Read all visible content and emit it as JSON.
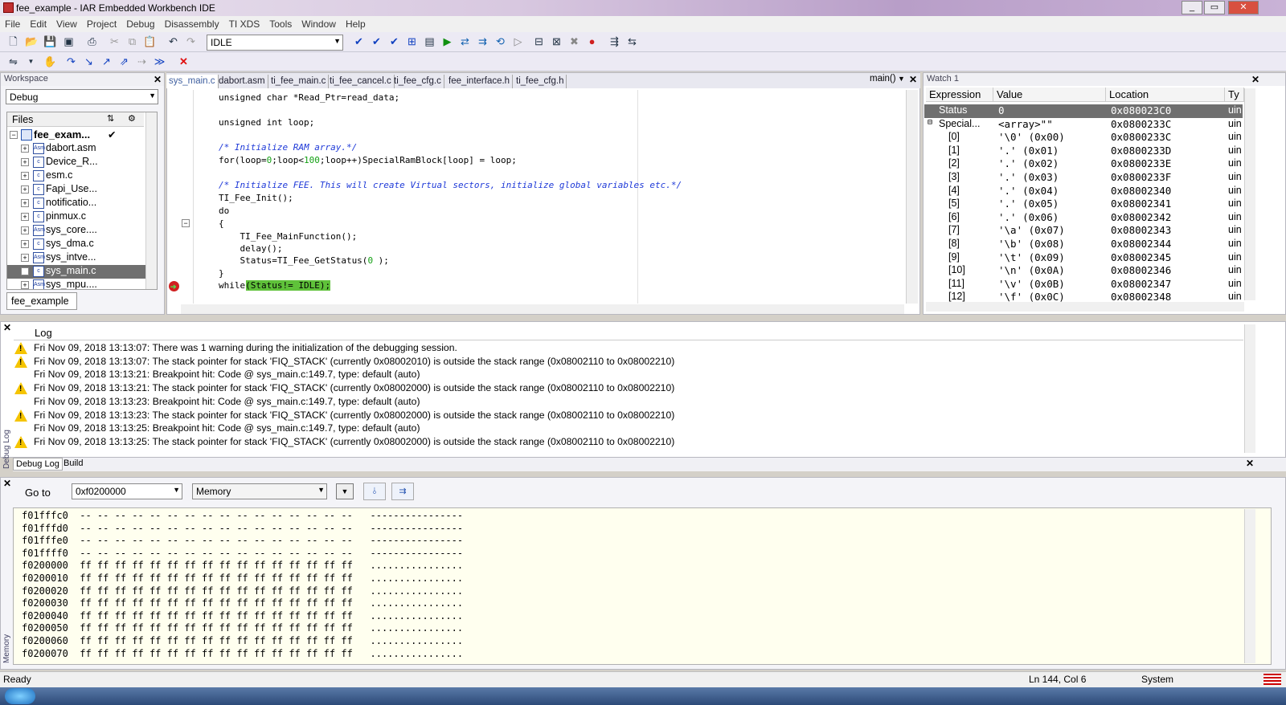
{
  "window": {
    "title": "fee_example - IAR Embedded Workbench IDE",
    "buttons": [
      "_",
      "▭",
      "✕"
    ]
  },
  "menu": [
    "File",
    "Edit",
    "View",
    "Project",
    "Debug",
    "Disassembly",
    "TI XDS",
    "Tools",
    "Window",
    "Help"
  ],
  "toolbar": {
    "config_combo": "IDLE"
  },
  "workspace": {
    "title": "Workspace",
    "config": "Debug",
    "files_header": "Files",
    "project": "fee_exam...",
    "files": [
      {
        "name": "dabort.asm",
        "type": "asm"
      },
      {
        "name": "Device_R...",
        "type": "c"
      },
      {
        "name": "esm.c",
        "type": "c"
      },
      {
        "name": "Fapi_Use...",
        "type": "c"
      },
      {
        "name": "notificatio...",
        "type": "c"
      },
      {
        "name": "pinmux.c",
        "type": "c"
      },
      {
        "name": "sys_core....",
        "type": "asm"
      },
      {
        "name": "sys_dma.c",
        "type": "c"
      },
      {
        "name": "sys_intve...",
        "type": "asm"
      },
      {
        "name": "sys_main.c",
        "type": "c"
      },
      {
        "name": "sys_mpu....",
        "type": "asm"
      }
    ],
    "bottom_tab": "fee_example"
  },
  "editor": {
    "tabs": [
      "sys_main.c",
      "dabort.asm",
      "ti_fee_main.c",
      "ti_fee_cancel.c",
      "ti_fee_cfg.c",
      "fee_interface.h",
      "ti_fee_cfg.h"
    ],
    "function": "main()",
    "lines": [
      "unsigned char *Read_Ptr=read_data;",
      "unsigned int loop;",
      "/* Initialize RAM array.*/",
      "for(loop=0;loop<100;loop++)SpecialRamBlock[loop] = loop;",
      "/* Initialize FEE. This will create Virtual sectors, initialize global variables etc.*/",
      "TI_Fee_Init();",
      "do",
      "{",
      "    TI_Fee_MainFunction();",
      "    delay();",
      "    Status=TI_Fee_GetStatus(0 );",
      "}",
      "while(Status!= IDLE);"
    ]
  },
  "watch": {
    "title": "Watch 1",
    "columns": [
      "Expression",
      "Value",
      "Location",
      "Ty"
    ],
    "rows": [
      {
        "expr": "Status",
        "value": "0",
        "loc": "0x080023C0",
        "type": "uin"
      },
      {
        "expr": "Special...",
        "value": "<array>\"\"",
        "loc": "0x0800233C",
        "type": "uin"
      },
      {
        "expr": "[0]",
        "value": "'\\0' (0x00)",
        "loc": "0x0800233C",
        "type": "uin"
      },
      {
        "expr": "[1]",
        "value": "'.' (0x01)",
        "loc": "0x0800233D",
        "type": "uin"
      },
      {
        "expr": "[2]",
        "value": "'.' (0x02)",
        "loc": "0x0800233E",
        "type": "uin"
      },
      {
        "expr": "[3]",
        "value": "'.' (0x03)",
        "loc": "0x0800233F",
        "type": "uin"
      },
      {
        "expr": "[4]",
        "value": "'.' (0x04)",
        "loc": "0x08002340",
        "type": "uin"
      },
      {
        "expr": "[5]",
        "value": "'.' (0x05)",
        "loc": "0x08002341",
        "type": "uin"
      },
      {
        "expr": "[6]",
        "value": "'.' (0x06)",
        "loc": "0x08002342",
        "type": "uin"
      },
      {
        "expr": "[7]",
        "value": "'\\a' (0x07)",
        "loc": "0x08002343",
        "type": "uin"
      },
      {
        "expr": "[8]",
        "value": "'\\b' (0x08)",
        "loc": "0x08002344",
        "type": "uin"
      },
      {
        "expr": "[9]",
        "value": "'\\t' (0x09)",
        "loc": "0x08002345",
        "type": "uin"
      },
      {
        "expr": "[10]",
        "value": "'\\n' (0x0A)",
        "loc": "0x08002346",
        "type": "uin"
      },
      {
        "expr": "[11]",
        "value": "'\\v' (0x0B)",
        "loc": "0x08002347",
        "type": "uin"
      },
      {
        "expr": "[12]",
        "value": "'\\f' (0x0C)",
        "loc": "0x08002348",
        "type": "uin"
      }
    ]
  },
  "log": {
    "header": "Log",
    "side_label": "Debug Log",
    "tabs": [
      "Debug Log",
      "Build"
    ],
    "entries": [
      {
        "warn": true,
        "text": "Fri Nov 09, 2018 13:13:07: There was 1 warning during the initialization of the debugging session."
      },
      {
        "warn": true,
        "text": "Fri Nov 09, 2018 13:13:07: The stack pointer for stack 'FIQ_STACK' (currently 0x08002010) is outside the stack range (0x08002110 to 0x08002210)"
      },
      {
        "warn": false,
        "text": "Fri Nov 09, 2018 13:13:21: Breakpoint hit: Code @ sys_main.c:149.7, type: default (auto)"
      },
      {
        "warn": true,
        "text": "Fri Nov 09, 2018 13:13:21: The stack pointer for stack 'FIQ_STACK' (currently 0x08002000) is outside the stack range (0x08002110 to 0x08002210)"
      },
      {
        "warn": false,
        "text": "Fri Nov 09, 2018 13:13:23: Breakpoint hit: Code @ sys_main.c:149.7, type: default (auto)"
      },
      {
        "warn": true,
        "text": "Fri Nov 09, 2018 13:13:23: The stack pointer for stack 'FIQ_STACK' (currently 0x08002000) is outside the stack range (0x08002110 to 0x08002210)"
      },
      {
        "warn": false,
        "text": "Fri Nov 09, 2018 13:13:25: Breakpoint hit: Code @ sys_main.c:149.7, type: default (auto)"
      },
      {
        "warn": true,
        "text": "Fri Nov 09, 2018 13:13:25: The stack pointer for stack 'FIQ_STACK' (currently 0x08002000) is outside the stack range (0x08002110 to 0x08002210)"
      }
    ]
  },
  "memory": {
    "goto_label": "Go to",
    "goto_value": "0xf0200000",
    "zone": "Memory",
    "side_label": "Memory",
    "rows": [
      {
        "addr": "f01fffc0",
        "bytes": "-- -- -- -- -- -- -- -- -- -- -- -- -- -- -- --",
        "ascii": "----------------"
      },
      {
        "addr": "f01fffd0",
        "bytes": "-- -- -- -- -- -- -- -- -- -- -- -- -- -- -- --",
        "ascii": "----------------"
      },
      {
        "addr": "f01fffe0",
        "bytes": "-- -- -- -- -- -- -- -- -- -- -- -- -- -- -- --",
        "ascii": "----------------"
      },
      {
        "addr": "f01ffff0",
        "bytes": "-- -- -- -- -- -- -- -- -- -- -- -- -- -- -- --",
        "ascii": "----------------"
      },
      {
        "addr": "f0200000",
        "bytes": "ff ff ff ff ff ff ff ff ff ff ff ff ff ff ff ff",
        "ascii": "................"
      },
      {
        "addr": "f0200010",
        "bytes": "ff ff ff ff ff ff ff ff ff ff ff ff ff ff ff ff",
        "ascii": "................"
      },
      {
        "addr": "f0200020",
        "bytes": "ff ff ff ff ff ff ff ff ff ff ff ff ff ff ff ff",
        "ascii": "................"
      },
      {
        "addr": "f0200030",
        "bytes": "ff ff ff ff ff ff ff ff ff ff ff ff ff ff ff ff",
        "ascii": "................"
      },
      {
        "addr": "f0200040",
        "bytes": "ff ff ff ff ff ff ff ff ff ff ff ff ff ff ff ff",
        "ascii": "................"
      },
      {
        "addr": "f0200050",
        "bytes": "ff ff ff ff ff ff ff ff ff ff ff ff ff ff ff ff",
        "ascii": "................"
      },
      {
        "addr": "f0200060",
        "bytes": "ff ff ff ff ff ff ff ff ff ff ff ff ff ff ff ff",
        "ascii": "................"
      },
      {
        "addr": "f0200070",
        "bytes": "ff ff ff ff ff ff ff ff ff ff ff ff ff ff ff ff",
        "ascii": "................"
      }
    ]
  },
  "status": {
    "left": "Ready",
    "position": "Ln 144, Col 6",
    "mode": "System"
  },
  "colors": {
    "highlight_green": "#5fc23a",
    "comment_blue": "#1f3ad8",
    "number_green": "#13a013",
    "warning_yellow": "#f5c400",
    "watch_selected": "#6f6f6f",
    "memory_bg": "#ffffef"
  }
}
